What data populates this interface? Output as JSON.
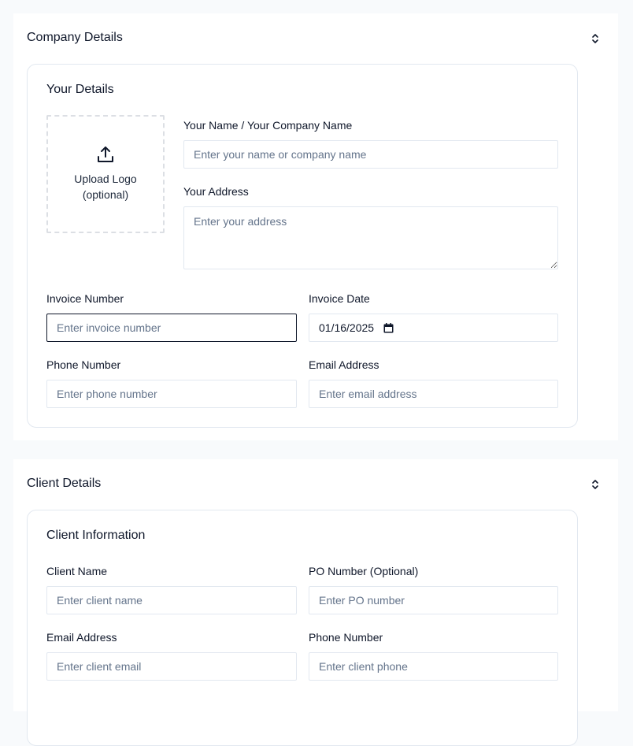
{
  "company": {
    "section_title": "Company Details",
    "card_title": "Your Details",
    "logo_label_1": "Upload Logo",
    "logo_label_2": "(optional)",
    "name_label": "Your Name / Your Company Name",
    "name_placeholder": "Enter your name or company name",
    "address_label": "Your Address",
    "address_placeholder": "Enter your address",
    "invoice_number_label": "Invoice Number",
    "invoice_number_placeholder": "Enter invoice number",
    "invoice_date_label": "Invoice Date",
    "invoice_date_value": "01/16/2025",
    "phone_label": "Phone Number",
    "phone_placeholder": "Enter phone number",
    "email_label": "Email Address",
    "email_placeholder": "Enter email address"
  },
  "client": {
    "section_title": "Client Details",
    "card_title": "Client Information",
    "name_label": "Client Name",
    "name_placeholder": "Enter client name",
    "po_label": "PO Number (Optional)",
    "po_placeholder": "Enter PO number",
    "email_label": "Email Address",
    "email_placeholder": "Enter client email",
    "phone_label": "Phone Number",
    "phone_placeholder": "Enter client phone"
  },
  "icons": {
    "collapse": "chevrons-up-down-icon",
    "upload": "upload-icon",
    "calendar": "calendar-icon"
  }
}
